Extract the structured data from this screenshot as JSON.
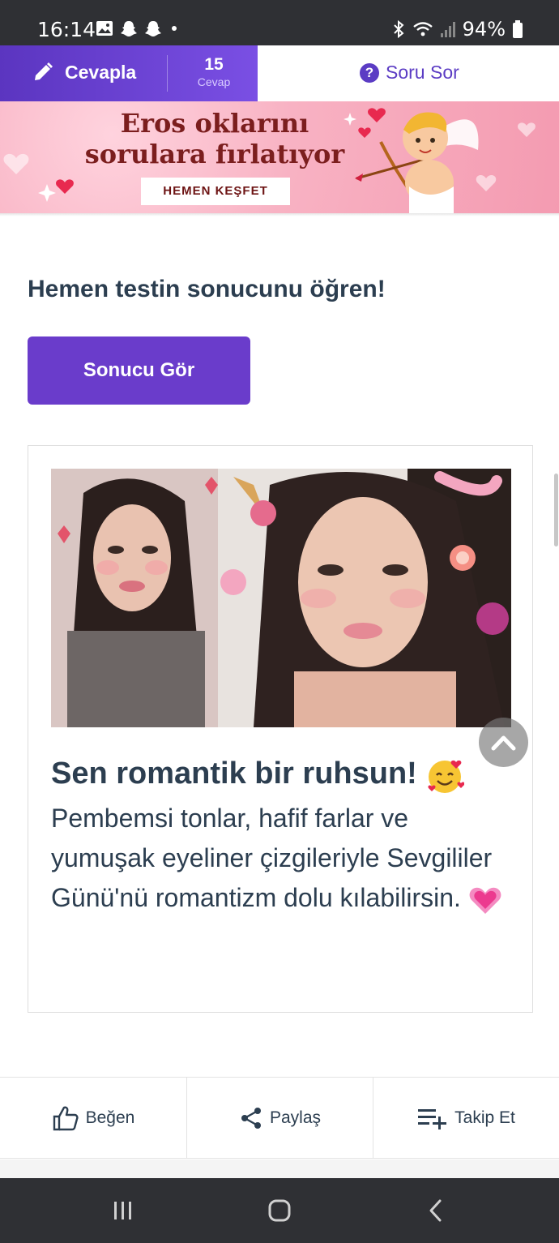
{
  "status": {
    "time": "16:14",
    "battery": "94%",
    "left_icons": [
      "gallery-icon",
      "snapchat-icon",
      "snapchat-icon",
      "dot-icon"
    ],
    "right_icons": [
      "bluetooth-icon",
      "wifi-icon",
      "signal-icon",
      "battery-icon"
    ]
  },
  "topbar": {
    "answer_label": "Cevapla",
    "answer_count": "15",
    "answer_count_label": "Cevap",
    "ask_label": "Soru Sor",
    "accent": "#6a3ccb"
  },
  "banner": {
    "line1": "Eros oklarını",
    "line2": "sorulara fırlatıyor",
    "cta": "HEMEN KEŞFET"
  },
  "main": {
    "heading": "Hemen testin sonucunu öğren!",
    "result_button": "Sonucu Gör"
  },
  "card": {
    "title": "Sen romantik bir ruhsun!",
    "description": "Pembemsi tonlar, hafif farlar ve yumuşak eyeliner çizgileriyle Sevgililer Günü'nü romantizm dolu kılabilirsin."
  },
  "actions": {
    "like": "Beğen",
    "share": "Paylaş",
    "follow": "Takip Et"
  },
  "nav": {
    "icons": [
      "recent-apps-icon",
      "home-icon",
      "back-icon"
    ]
  }
}
